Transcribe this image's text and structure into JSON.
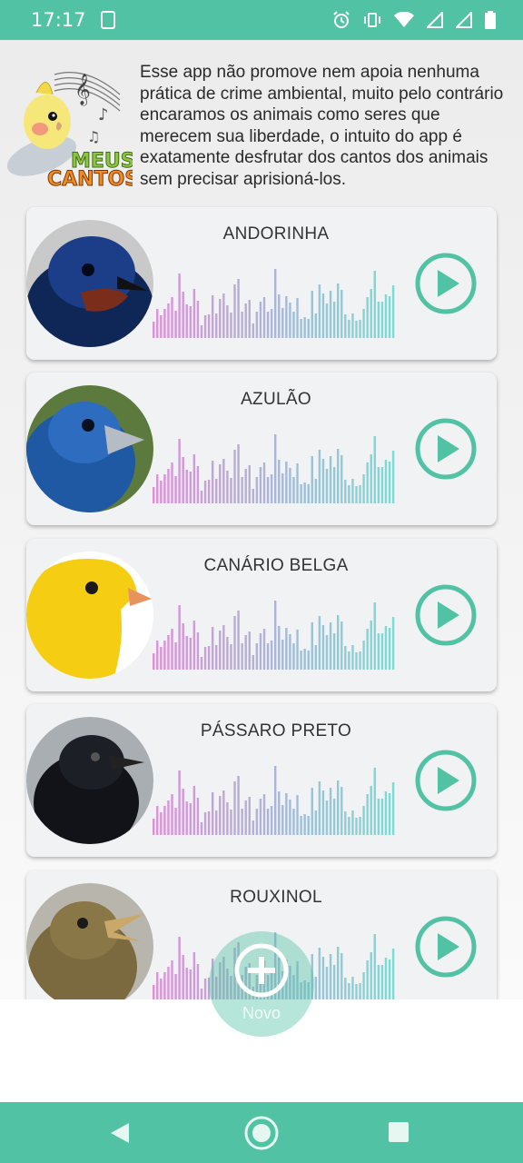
{
  "status_bar": {
    "time": "17:17",
    "icons": [
      "screen-share-icon",
      "alarm-icon",
      "vibrate-icon",
      "wifi-icon",
      "signal-icon",
      "signal-icon",
      "battery-icon"
    ]
  },
  "header": {
    "logo_text_line1": "MEUS",
    "logo_text_line2": "CANTOS",
    "disclaimer": "Esse app não promove nem apoia nenhuma prática de crime ambiental, muito pelo contrário encaramos os animais como seres que merecem sua liberdade, o intuito do app é exatamente desfrutar dos cantos dos animais sem precisar aprisioná-los."
  },
  "birds": [
    {
      "name": "ANDORINHA",
      "image": "swallow-photo"
    },
    {
      "name": "AZULÃO",
      "image": "blue-grosbeak-photo"
    },
    {
      "name": "CANÁRIO BELGA",
      "image": "canary-photo"
    },
    {
      "name": "PÁSSARO PRETO",
      "image": "blackbird-photo"
    },
    {
      "name": "ROUXINOL",
      "image": "nightingale-photo"
    }
  ],
  "fab": {
    "label": "Novo"
  },
  "colors": {
    "accent": "#52c2a4",
    "wave_start": "#d66fd0",
    "wave_end": "#4fd4cd"
  }
}
